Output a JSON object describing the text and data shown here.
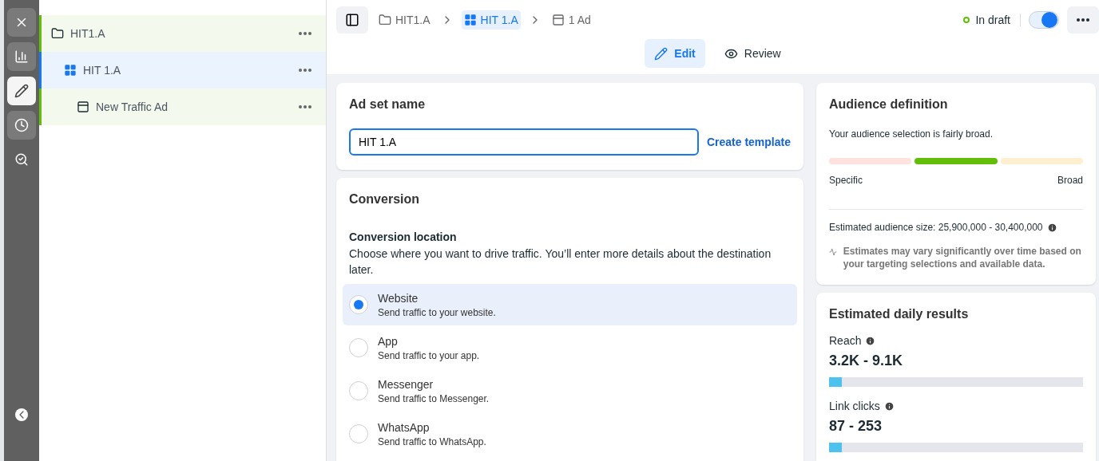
{
  "rail": {
    "buttons": [
      {
        "kind": "close",
        "selected": false
      },
      {
        "kind": "chart",
        "selected": false
      },
      {
        "kind": "edit",
        "selected": true
      },
      {
        "kind": "clock",
        "selected": false
      },
      {
        "kind": "search",
        "selected": false
      }
    ]
  },
  "tree": [
    {
      "kind": "folder",
      "label": "HIT1.A",
      "selected": false,
      "children": [
        {
          "kind": "adset",
          "label": "HIT 1.A",
          "selected": true,
          "children": [
            {
              "kind": "ad",
              "label": "New Traffic Ad",
              "selected": false
            }
          ]
        }
      ]
    }
  ],
  "breadcrumbs": [
    {
      "kind": "folder",
      "label": "HIT1.A",
      "selected": false
    },
    {
      "kind": "adset",
      "label": "HIT 1.A",
      "selected": true
    },
    {
      "kind": "ad",
      "label": "1 Ad",
      "selected": false
    }
  ],
  "status": {
    "label": "In draft",
    "on": true
  },
  "tabs": [
    {
      "kind": "edit",
      "label": "Edit",
      "selected": true
    },
    {
      "kind": "review",
      "label": "Review",
      "selected": false
    }
  ],
  "ad_set_name": {
    "title": "Ad set name",
    "value": "HIT 1.A",
    "link": "Create template"
  },
  "conversion": {
    "title": "Conversion",
    "subtitle": "Conversion location",
    "description": "Choose where you want to drive traffic. You’ll enter more details about the destination later.",
    "options": [
      {
        "label": "Website",
        "hint": "Send traffic to your website.",
        "selected": true
      },
      {
        "label": "App",
        "hint": "Send traffic to your app.",
        "selected": false
      },
      {
        "label": "Messenger",
        "hint": "Send traffic to Messenger.",
        "selected": false
      },
      {
        "label": "WhatsApp",
        "hint": "Send traffic to WhatsApp.",
        "selected": false
      }
    ]
  },
  "audience": {
    "title": "Audience definition",
    "summary": "Your audience selection is fairly broad.",
    "segments": [
      {
        "color": "#fde2de"
      },
      {
        "color": "#63be09"
      },
      {
        "color": "#fdefcf"
      }
    ],
    "low": "Specific",
    "high": "Broad",
    "size": "Estimated audience size: 25,900,000 - 30,400,000",
    "note": "Estimates may vary significantly over time based on your targeting selections and available data."
  },
  "results": {
    "title": "Estimated daily results",
    "metrics": [
      {
        "label": "Reach",
        "value": "3.2K - 9.1K",
        "level": 0.05
      },
      {
        "label": "Link clicks",
        "value": "87 - 253",
        "level": 0.05
      }
    ]
  }
}
